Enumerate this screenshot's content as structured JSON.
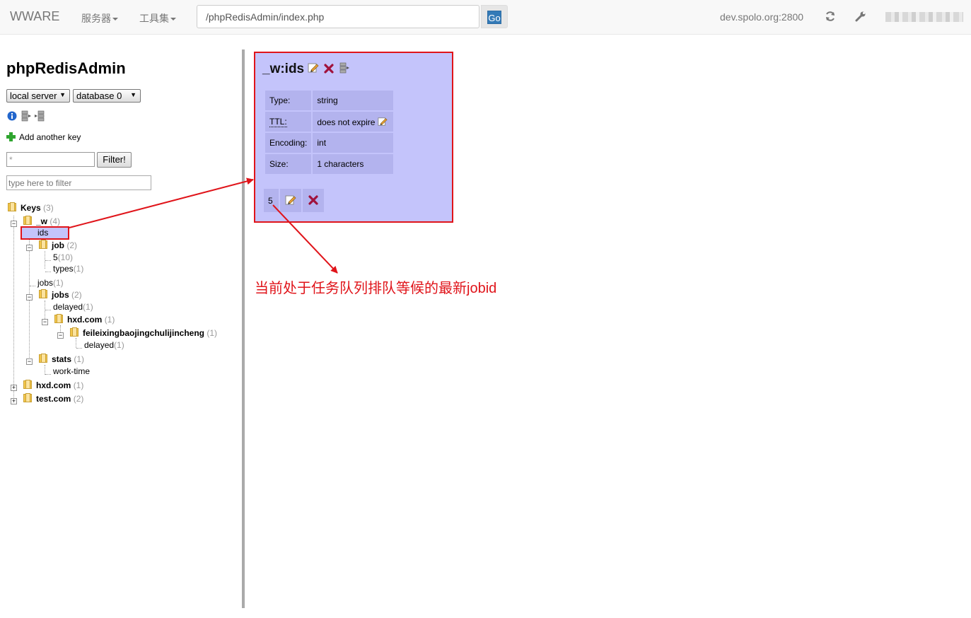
{
  "navbar": {
    "brand": "WWARE",
    "menu_servers": "服务器",
    "menu_tools": "工具集",
    "url": "/phpRedisAdmin/index.php",
    "go_label": "Go",
    "host": "dev.spolo.org:2800",
    "icons": [
      "refresh-icon",
      "wrench-icon"
    ]
  },
  "sidebar": {
    "title": "phpRedisAdmin",
    "server_select": "local server",
    "database_select": "database 0",
    "add_key_label": "Add another key",
    "pattern_value": "*",
    "filter_button": "Filter!",
    "filter_placeholder": "type here to filter",
    "tree": {
      "keys_label": "Keys",
      "keys_count": "(3)",
      "w_label": "_w",
      "w_count": "(4)",
      "ids_label": "ids",
      "job_label": "job",
      "job_count": "(2)",
      "job_5_label": "5",
      "job_5_count": "(10)",
      "types_label": "types",
      "types_count": "(1)",
      "jobs_leaf_label": "jobs",
      "jobs_leaf_count": "(1)",
      "jobs_label": "jobs",
      "jobs_count": "(2)",
      "delayed_label": "delayed",
      "delayed_count": "(1)",
      "hxd_sub_label": "hxd.com",
      "hxd_sub_count": "(1)",
      "feilei_label": "feileixingbaojingchulijincheng",
      "feilei_count": "(1)",
      "delayed2_label": "delayed",
      "delayed2_count": "(1)",
      "stats_label": "stats",
      "stats_count": "(1)",
      "worktime_label": "work-time",
      "hxd_label": "hxd.com",
      "hxd_count": "(1)",
      "test_label": "test.com",
      "test_count": "(2)"
    }
  },
  "key_detail": {
    "title": "_w:ids",
    "rows": [
      {
        "label": "Type:",
        "value": "string"
      },
      {
        "label": "TTL:",
        "value": "does not expire"
      },
      {
        "label": "Encoding:",
        "value": "int"
      },
      {
        "label": "Size:",
        "value": "1 characters"
      }
    ],
    "value": "5"
  },
  "annotation": {
    "text": "当前处于任务队列排队等候的最新jobid",
    "color": "#e0141a"
  },
  "colors": {
    "panel_bg": "#c4c4fb",
    "cell_bg": "#b3b3ee",
    "accent": "#337ab7"
  }
}
